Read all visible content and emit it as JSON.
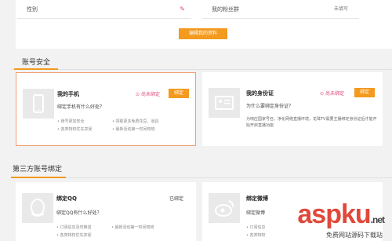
{
  "profile": {
    "gender_label": "性别",
    "fan_group_label": "我的粉丝群",
    "fan_group_value": "未填写",
    "edit_button": "编辑我的资料"
  },
  "account_security": {
    "title": "账号安全",
    "phone": {
      "title": "我的手机",
      "status": "尚未绑定",
      "button": "绑定",
      "question": "绑定手机有什么好处？",
      "benefits": [
        "账号更加安全",
        "领取更多免费花豆、道具",
        "各类特权优先享受",
        "最新活动第一时间知晓"
      ]
    },
    "id_card": {
      "title": "我的身份证",
      "status": "尚未绑定",
      "button": "绑定",
      "question": "为什么要绑定身份证？",
      "description": "为响应国家号召，净化网络直播环境，龙珠TV需要主播绑定身份证后才能开始开启直播功能"
    }
  },
  "third_party": {
    "title": "第三方账号绑定",
    "qq": {
      "title": "绑定QQ",
      "status": "已绑定",
      "question": "绑定QQ有什么好处？",
      "benefits": [
        "订阅信息及时推送",
        "最新活动第一时间知晓",
        "各类特权优先享受"
      ]
    },
    "weibo": {
      "title": "绑定微博",
      "question": "绑定微博",
      "benefits": [
        "订阅信息",
        "各类特权"
      ]
    }
  },
  "watermark": {
    "main": "asp",
    "accent": "ku",
    "suffix": ".net",
    "caption": "免费网站源码下载站"
  }
}
